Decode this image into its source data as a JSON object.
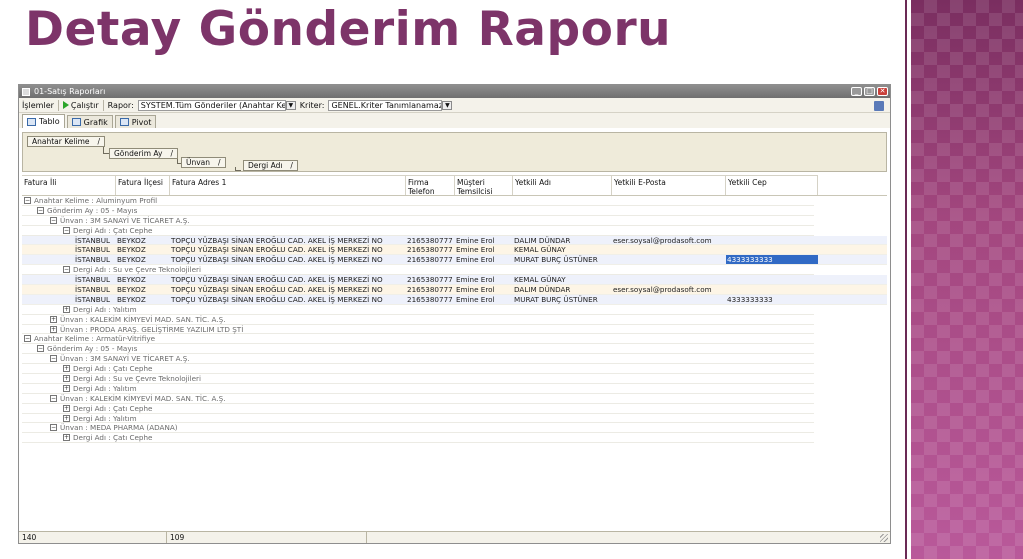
{
  "slide": {
    "title": "Detay Gönderim Raporu"
  },
  "window": {
    "title": "01-Satış Raporları",
    "buttons": {
      "minimize": "_",
      "maximize": "□",
      "close": "✕"
    }
  },
  "toolbar": {
    "menu_label": "İşlemler",
    "run_label": "Çalıştır",
    "rapor_label": "Rapor:",
    "rapor_value": "SYSTEM.Tüm Gönderiler (Anahtar Kel",
    "kriter_label": "Kriter:",
    "kriter_value": "GENEL.Kriter Tanımlanamaz"
  },
  "tabs": [
    {
      "label": "Tablo",
      "icon": "table-icon"
    },
    {
      "label": "Grafik",
      "icon": "chart-icon"
    },
    {
      "label": "Pivot",
      "icon": "pivot-icon"
    }
  ],
  "group_chips": [
    "Anahtar Kelime",
    "Gönderim Ay",
    "Ünvan",
    "Dergi Adı"
  ],
  "columns": [
    "Fatura İli",
    "Fatura İlçesi",
    "Fatura Adres 1",
    "Firma Telefon",
    "Müşteri Temsilcisi",
    "Yetkili Adı",
    "Yetkili E-Posta",
    "Yetkili Cep"
  ],
  "rows": [
    {
      "kind": "group",
      "level": 0,
      "sign": "−",
      "text": "Anahtar Kelime : Aluminyum Profil"
    },
    {
      "kind": "group",
      "level": 1,
      "sign": "−",
      "text": "Gönderim Ay : 05 - Mayıs"
    },
    {
      "kind": "group",
      "level": 2,
      "sign": "−",
      "text": "Ünvan : 3M SANAYİ VE TİCARET A.Ş."
    },
    {
      "kind": "group",
      "level": 3,
      "sign": "−",
      "text": "Dergi Adı : Çatı Cephe"
    },
    {
      "kind": "data",
      "style": "plain",
      "il": "İSTANBUL",
      "ilce": "BEYKOZ",
      "adres": "TOPÇU YÜZBAŞI SİNAN EROĞLU CAD. AKEL İŞ MERKEZİ NO",
      "tel": "2165380777",
      "temsilci": "Emine Erol",
      "yetkili": "DALIM DÜNDAR",
      "eposta": "eser.soysal@prodasoft.com",
      "cep": ""
    },
    {
      "kind": "data",
      "style": "alt",
      "il": "İSTANBUL",
      "ilce": "BEYKOZ",
      "adres": "TOPÇU YÜZBAŞI SİNAN EROĞLU CAD. AKEL İŞ MERKEZİ NO",
      "tel": "2165380777",
      "temsilci": "Emine Erol",
      "yetkili": "KEMAL GÜNAY",
      "eposta": "",
      "cep": ""
    },
    {
      "kind": "data",
      "style": "plain",
      "il": "İSTANBUL",
      "ilce": "BEYKOZ",
      "adres": "TOPÇU YÜZBAŞI SİNAN EROĞLU CAD. AKEL İŞ MERKEZİ NO",
      "tel": "2165380777",
      "temsilci": "Emine Erol",
      "yetkili": "MURAT BURÇ ÜSTÜNER",
      "eposta": "",
      "cep": "4333333333",
      "cep_selected": true
    },
    {
      "kind": "group",
      "level": 3,
      "sign": "−",
      "text": "Dergi Adı : Su ve Çevre Teknolojileri"
    },
    {
      "kind": "data",
      "style": "plain",
      "il": "İSTANBUL",
      "ilce": "BEYKOZ",
      "adres": "TOPÇU YÜZBAŞI SİNAN EROĞLU CAD. AKEL İŞ MERKEZİ NO",
      "tel": "2165380777",
      "temsilci": "Emine Erol",
      "yetkili": "KEMAL GÜNAY",
      "eposta": "",
      "cep": ""
    },
    {
      "kind": "data",
      "style": "alt",
      "il": "İSTANBUL",
      "ilce": "BEYKOZ",
      "adres": "TOPÇU YÜZBAŞI SİNAN EROĞLU CAD. AKEL İŞ MERKEZİ NO",
      "tel": "2165380777",
      "temsilci": "Emine Erol",
      "yetkili": "DALIM DÜNDAR",
      "eposta": "eser.soysal@prodasoft.com",
      "cep": ""
    },
    {
      "kind": "data",
      "style": "plain",
      "il": "İSTANBUL",
      "ilce": "BEYKOZ",
      "adres": "TOPÇU YÜZBAŞI SİNAN EROĞLU CAD. AKEL İŞ MERKEZİ NO",
      "tel": "2165380777",
      "temsilci": "Emine Erol",
      "yetkili": "MURAT BURÇ ÜSTÜNER",
      "eposta": "",
      "cep": "4333333333"
    },
    {
      "kind": "group",
      "level": 3,
      "sign": "+",
      "text": "Dergi Adı : Yalıtım"
    },
    {
      "kind": "group",
      "level": 2,
      "sign": "+",
      "text": "Ünvan : KALEKİM KİMYEVİ MAD. SAN. TİC. A.Ş."
    },
    {
      "kind": "group",
      "level": 2,
      "sign": "+",
      "text": "Ünvan : PRODA ARAŞ. GELİŞTİRME YAZILIM LTD ŞTİ"
    },
    {
      "kind": "group",
      "level": 0,
      "sign": "−",
      "text": "Anahtar Kelime : Armatür-Vitrifiye"
    },
    {
      "kind": "group",
      "level": 1,
      "sign": "−",
      "text": "Gönderim Ay : 05 - Mayıs"
    },
    {
      "kind": "group",
      "level": 2,
      "sign": "−",
      "text": "Ünvan : 3M SANAYİ VE TİCARET A.Ş."
    },
    {
      "kind": "group",
      "level": 3,
      "sign": "+",
      "text": "Dergi Adı : Çatı Cephe"
    },
    {
      "kind": "group",
      "level": 3,
      "sign": "+",
      "text": "Dergi Adı : Su ve Çevre Teknolojileri"
    },
    {
      "kind": "group",
      "level": 3,
      "sign": "+",
      "text": "Dergi Adı : Yalıtım"
    },
    {
      "kind": "group",
      "level": 2,
      "sign": "−",
      "text": "Ünvan : KALEKİM KİMYEVİ MAD. SAN. TİC. A.Ş."
    },
    {
      "kind": "group",
      "level": 3,
      "sign": "+",
      "text": "Dergi Adı : Çatı Cephe"
    },
    {
      "kind": "group",
      "level": 3,
      "sign": "+",
      "text": "Dergi Adı : Yalıtım"
    },
    {
      "kind": "group",
      "level": 2,
      "sign": "−",
      "text": "Ünvan : MEDA PHARMA (ADANA)"
    },
    {
      "kind": "group",
      "level": 3,
      "sign": "+",
      "text": "Dergi Adı : Çatı Cephe"
    }
  ],
  "status": {
    "left": "140",
    "middle": "109"
  }
}
